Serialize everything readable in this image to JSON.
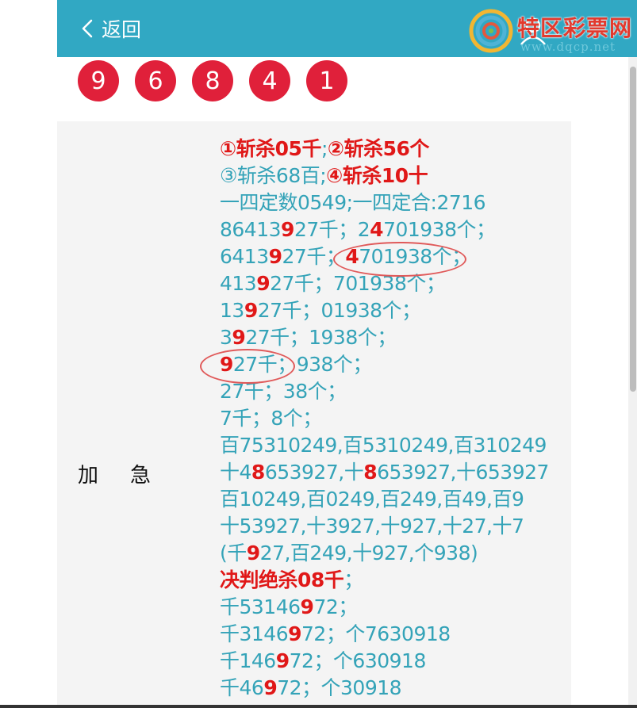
{
  "header": {
    "back_label": "返回",
    "back_icon": "chevron-left-icon",
    "user_icon": "user-icon",
    "watermark_title": "特区彩票网",
    "watermark_url": "www.dqcp.net"
  },
  "balls": [
    "9",
    "6",
    "8",
    "4",
    "1"
  ],
  "side_label": "加急",
  "colors": {
    "header": "#31a8c3",
    "ball": "#e0203a",
    "text": "#34a3b8",
    "highlight": "#e01818"
  },
  "lines": [
    [
      [
        "①斩杀05千",
        true
      ],
      [
        ";",
        false
      ],
      [
        "②斩杀56个",
        true
      ]
    ],
    [
      [
        "③斩杀68百;",
        false
      ],
      [
        "④斩杀10十",
        true
      ]
    ],
    [
      [
        "一四定数0549;一四定合:2716",
        false
      ]
    ],
    [
      [
        "86413",
        false
      ],
      [
        "9",
        true
      ],
      [
        "27千；2",
        false
      ],
      [
        "4",
        true
      ],
      [
        "701938个；",
        false
      ]
    ],
    [
      [
        "6413",
        false
      ],
      [
        "9",
        true
      ],
      [
        "27千；",
        false
      ],
      [
        "4",
        true
      ],
      [
        "701938个；",
        false
      ]
    ],
    [
      [
        "413",
        false
      ],
      [
        "9",
        true
      ],
      [
        "27千；701938个；",
        false
      ]
    ],
    [
      [
        "13",
        false
      ],
      [
        "9",
        true
      ],
      [
        "27千；01938个；",
        false
      ]
    ],
    [
      [
        "3",
        false
      ],
      [
        "9",
        true
      ],
      [
        "27千；1938个；",
        false
      ]
    ],
    [
      [
        "9",
        true
      ],
      [
        "27千；938个；",
        false
      ]
    ],
    [
      [
        "27千；38个；",
        false
      ]
    ],
    [
      [
        "7千；8个；",
        false
      ]
    ],
    [
      [
        "百75310249,百5310249,百310249",
        false
      ]
    ],
    [
      [
        "十4",
        false
      ],
      [
        "8",
        true
      ],
      [
        "653927,十",
        false
      ],
      [
        "8",
        true
      ],
      [
        "653927,十653927",
        false
      ]
    ],
    [
      [
        "百10249,百0249,百249,百49,百9",
        false
      ]
    ],
    [
      [
        "十53927,十3927,十927,十27,十7",
        false
      ]
    ],
    [
      [
        "(千",
        false
      ],
      [
        "9",
        true
      ],
      [
        "27,百249,十927,个938)",
        false
      ]
    ],
    [
      [
        "决判绝杀08千",
        true
      ],
      [
        "；",
        false
      ]
    ],
    [
      [
        "千53146",
        false
      ],
      [
        "9",
        true
      ],
      [
        "72；",
        false
      ]
    ],
    [
      [
        "千3146",
        false
      ],
      [
        "9",
        true
      ],
      [
        "72；个7630918",
        false
      ]
    ],
    [
      [
        "千146",
        false
      ],
      [
        "9",
        true
      ],
      [
        "72；个630918",
        false
      ]
    ],
    [
      [
        "千46",
        false
      ],
      [
        "9",
        true
      ],
      [
        "72；个30918",
        false
      ]
    ]
  ]
}
